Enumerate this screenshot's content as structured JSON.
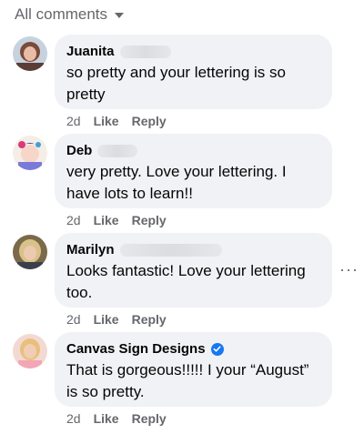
{
  "header": {
    "label": "All comments"
  },
  "comments": [
    {
      "name": "Juanita",
      "text": "so pretty and your lettering is so pretty",
      "time": "2d",
      "like": "Like",
      "reply": "Reply"
    },
    {
      "name": "Deb",
      "text": "very pretty. Love your lettering. I have lots to learn!!",
      "time": "2d",
      "like": "Like",
      "reply": "Reply"
    },
    {
      "name": "Marilyn",
      "text": "Looks fantastic! Love your lettering too.",
      "time": "2d",
      "like": "Like",
      "reply": "Reply",
      "more": "···"
    },
    {
      "name": "Canvas Sign Designs",
      "text": "That is gorgeous!!!!! I your “August” is so pretty.",
      "time": "2d",
      "like": "Like",
      "reply": "Reply"
    }
  ],
  "colors": {
    "bubble": "#f0f2f5",
    "meta": "#65676b",
    "verified": "#1877f2"
  },
  "icons": {
    "sort": "caret-down-icon",
    "verified": "verified-badge-icon",
    "more": "more-options-icon"
  }
}
